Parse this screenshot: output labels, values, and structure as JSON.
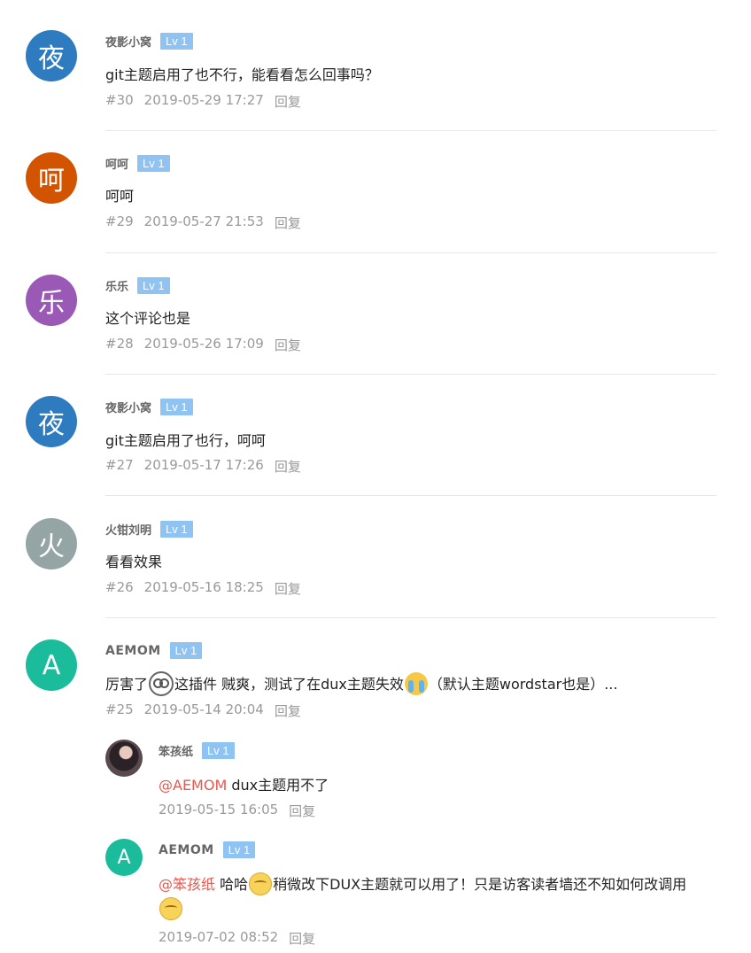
{
  "comments": [
    {
      "avatar_char": "夜",
      "avatar_color": "#2e7bbf",
      "author": "夜影小窝",
      "level": "Lv 1",
      "text": "git主题启用了也不行，能看看怎么回事吗？",
      "floor": "#30",
      "date": "2019-05-29 17:27",
      "reply": "回复"
    },
    {
      "avatar_char": "呵",
      "avatar_color": "#d35400",
      "author": "呵呵",
      "level": "Lv 1",
      "text": "呵呵",
      "floor": "#29",
      "date": "2019-05-27 21:53",
      "reply": "回复"
    },
    {
      "avatar_char": "乐",
      "avatar_color": "#9b59b6",
      "author": "乐乐",
      "level": "Lv 1",
      "text": "这个评论也是",
      "floor": "#28",
      "date": "2019-05-26 17:09",
      "reply": "回复"
    },
    {
      "avatar_char": "夜",
      "avatar_color": "#2e7bbf",
      "author": "夜影小窝",
      "level": "Lv 1",
      "text": "git主题启用了也行，呵呵",
      "floor": "#27",
      "date": "2019-05-17 17:26",
      "reply": "回复"
    },
    {
      "avatar_char": "火",
      "avatar_color": "#95a5a6",
      "author": "火钳刘明",
      "level": "Lv 1",
      "text": "看看效果",
      "floor": "#26",
      "date": "2019-05-16 18:25",
      "reply": "回复"
    },
    {
      "avatar_char": "A",
      "avatar_color": "#1abc9c",
      "author": "AEMOM",
      "level": "Lv 1",
      "text_part1": "厉害了",
      "emoji1": "ghost-face-icon",
      "text_part2": "这插件 贼爽，测试了在dux主题失效",
      "emoji2": "crying-face-icon",
      "text_part3": "（默认主题wordstar也是）...",
      "floor": "#25",
      "date": "2019-05-14 20:04",
      "reply": "回复"
    }
  ],
  "replies": [
    {
      "avatar_type": "photo",
      "author": "笨孩纸",
      "level": "Lv 1",
      "mention": "@AEMOM",
      "text": "dux主题用不了",
      "date": "2019-05-15 16:05",
      "reply": "回复"
    },
    {
      "avatar_char": "A",
      "avatar_color": "#1abc9c",
      "author": "AEMOM",
      "level": "Lv 1",
      "mention": "@笨孩纸",
      "text_part1": "哈哈",
      "emoji1": "grin-face-icon",
      "text_part2": "稍微改下DUX主题就可以用了！只是访客读者墙还不知如何改调用",
      "emoji2": "smile-face-icon",
      "date": "2019-07-02 08:52",
      "reply": "回复"
    }
  ]
}
